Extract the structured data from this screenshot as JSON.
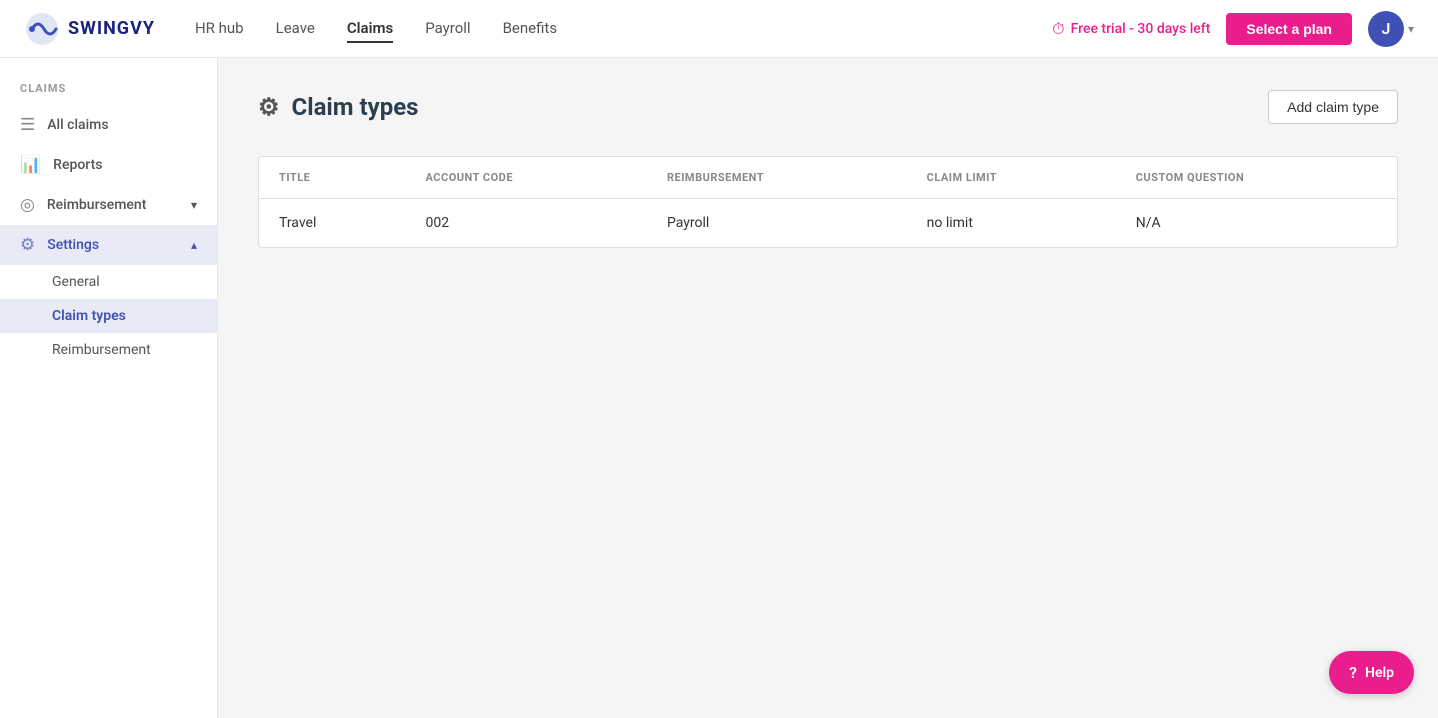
{
  "app": {
    "name": "SWINGVY"
  },
  "topnav": {
    "links": [
      {
        "id": "hr-hub",
        "label": "HR hub",
        "active": false
      },
      {
        "id": "leave",
        "label": "Leave",
        "active": false
      },
      {
        "id": "claims",
        "label": "Claims",
        "active": true
      },
      {
        "id": "payroll",
        "label": "Payroll",
        "active": false
      },
      {
        "id": "benefits",
        "label": "Benefits",
        "active": false
      }
    ],
    "free_trial_text": "Free trial - 30 days left",
    "select_plan_label": "Select a plan",
    "avatar_letter": "J"
  },
  "sidebar": {
    "section_label": "CLAIMS",
    "items": [
      {
        "id": "all-claims",
        "label": "All claims",
        "icon": "☰",
        "active": false
      },
      {
        "id": "reports",
        "label": "Reports",
        "icon": "📊",
        "active": false
      },
      {
        "id": "reimbursement",
        "label": "Reimbursement",
        "icon": "⊙",
        "active": false,
        "has_chevron": true
      },
      {
        "id": "settings",
        "label": "Settings",
        "icon": "⚙",
        "active": true,
        "has_chevron": true,
        "expanded": true
      }
    ],
    "settings_sub_items": [
      {
        "id": "general",
        "label": "General",
        "active": false
      },
      {
        "id": "claim-types",
        "label": "Claim types",
        "active": true
      },
      {
        "id": "reimbursement-sub",
        "label": "Reimbursement",
        "active": false
      }
    ]
  },
  "page": {
    "title": "Claim types",
    "title_icon": "⚙",
    "add_button_label": "Add claim type"
  },
  "table": {
    "columns": [
      {
        "id": "title",
        "label": "TITLE"
      },
      {
        "id": "account-code",
        "label": "ACCOUNT CODE"
      },
      {
        "id": "reimbursement",
        "label": "REIMBURSEMENT"
      },
      {
        "id": "claim-limit",
        "label": "CLAIM LIMIT"
      },
      {
        "id": "custom-question",
        "label": "CUSTOM QUESTION"
      }
    ],
    "rows": [
      {
        "title": "Travel",
        "account_code": "002",
        "reimbursement": "Payroll",
        "claim_limit": "no limit",
        "custom_question": "N/A"
      }
    ]
  },
  "help": {
    "label": "Help"
  }
}
